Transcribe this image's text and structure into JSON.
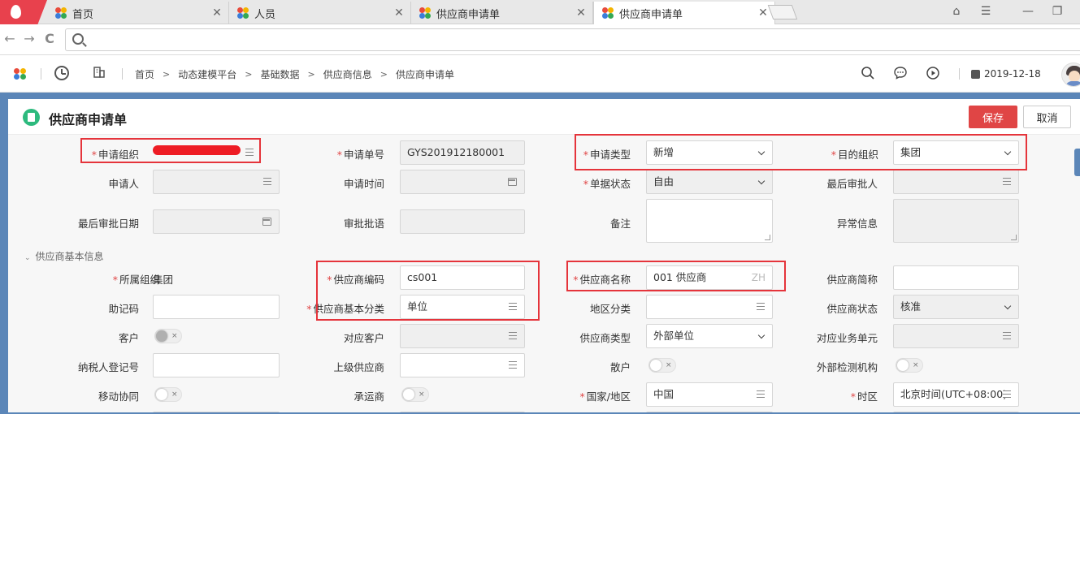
{
  "browser": {
    "tabs": [
      {
        "label": "首页",
        "close": "✕"
      },
      {
        "label": "人员",
        "close": "✕"
      },
      {
        "label": "供应商申请单",
        "close": "✕"
      },
      {
        "label": "供应商申请单",
        "close": "✕"
      }
    ],
    "url_value": "",
    "nav": {
      "back": "←",
      "forward": "→",
      "reload": "C"
    },
    "window": {
      "minimize": "—",
      "menu": "☰",
      "account": "⌂",
      "restore": "❐"
    }
  },
  "header": {
    "breadcrumb": [
      "首页",
      "动态建模平台",
      "基础数据",
      "供应商信息",
      "供应商申请单"
    ],
    "date": "2019-12-18"
  },
  "page": {
    "title": "供应商申请单",
    "save_label": "保存",
    "cancel_label": "取消"
  },
  "form": {
    "apply_org_label": "申请组织",
    "apply_no_label": "申请单号",
    "apply_no_value": "GYS201912180001",
    "apply_type_label": "申请类型",
    "apply_type_value": "新增",
    "target_org_label": "目的组织",
    "target_org_value": "集团",
    "applicant_label": "申请人",
    "apply_time_label": "申请时间",
    "doc_status_label": "单据状态",
    "doc_status_value": "自由",
    "last_approver_label": "最后审批人",
    "last_approve_date_label": "最后审批日期",
    "approve_comment_label": "审批批语",
    "remark_label": "备注",
    "exception_label": "异常信息"
  },
  "section": {
    "title": "供应商基本信息",
    "arrow": "⌄"
  },
  "basic": {
    "belong_org_label": "所属组织",
    "belong_org_value": "集团",
    "supplier_code_label": "供应商编码",
    "supplier_code_value": "cs001",
    "supplier_name_label": "供应商名称",
    "supplier_name_value": "001 供应商",
    "supplier_name_lang": "ZH",
    "supplier_short_label": "供应商简称",
    "mnemonic_label": "助记码",
    "basic_class_label": "供应商基本分类",
    "basic_class_value": "单位",
    "region_class_label": "地区分类",
    "supplier_status_label": "供应商状态",
    "supplier_status_value": "核准",
    "customer_label": "客户",
    "corr_customer_label": "对应客户",
    "supplier_type_label": "供应商类型",
    "supplier_type_value": "外部单位",
    "corr_unit_label": "对应业务单元",
    "taxpayer_label": "纳税人登记号",
    "parent_supplier_label": "上级供应商",
    "loose_label": "散户",
    "ext_inspect_label": "外部检测机构",
    "mobile_label": "移动协同",
    "carrier_label": "承运商",
    "country_label": "国家/地区",
    "country_value": "中国",
    "timezone_label": "时区",
    "timezone_value": "北京时间(UTC+08:00)",
    "toggle_x": "×"
  },
  "colors": {
    "accent_red": "#e04545",
    "band_blue": "#5b86b8",
    "title_icon_green": "#2dba7e",
    "annotation_red": "#e5343b"
  }
}
